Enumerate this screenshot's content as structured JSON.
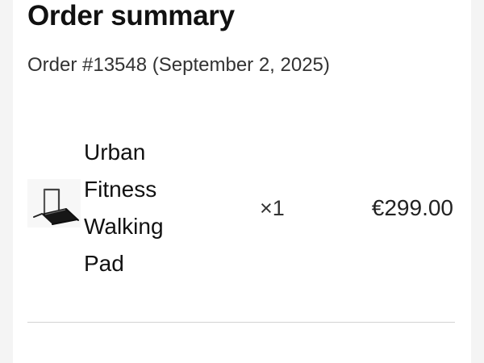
{
  "page": {
    "title": "Order summary",
    "order_meta": "Order #13548 (September 2, 2025)"
  },
  "items": [
    {
      "name": "Urban Fitness Walking Pad",
      "quantity": "×1",
      "price": "€299.00",
      "thumbnail_icon": "walking-pad-treadmill-image"
    }
  ]
}
